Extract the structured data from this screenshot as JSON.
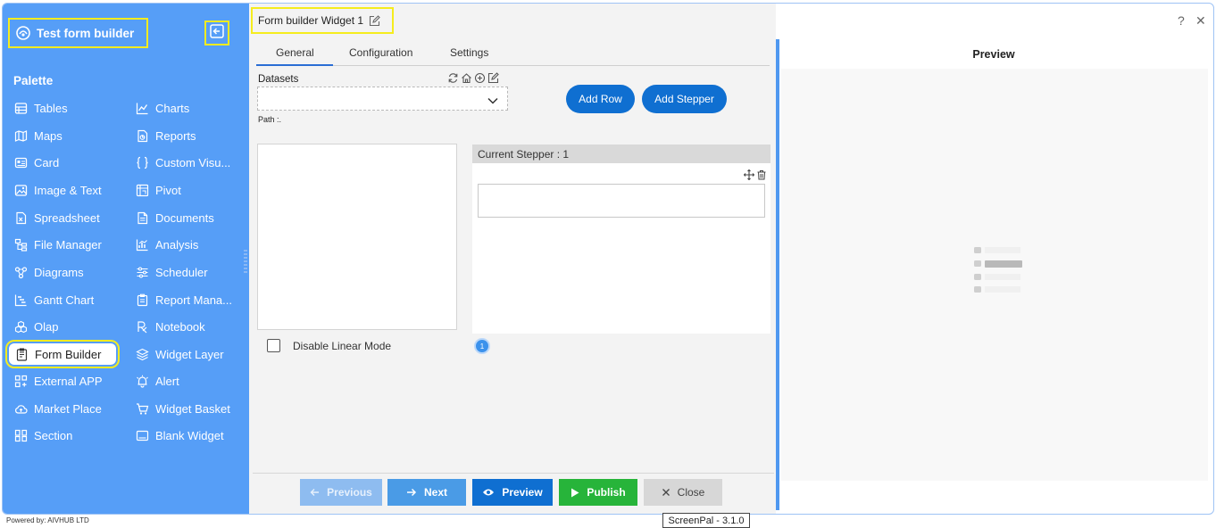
{
  "sidebar": {
    "app_title": "Test form builder",
    "palette_title": "Palette",
    "left_items": [
      "Tables",
      "Maps",
      "Card",
      "Image & Text",
      "Spreadsheet",
      "File Manager",
      "Diagrams",
      "Gantt Chart",
      "Olap",
      "Form Builder",
      "External APP",
      "Market Place",
      "Section"
    ],
    "right_items": [
      "Charts",
      "Reports",
      "Custom Visu...",
      "Pivot",
      "Documents",
      "Analysis",
      "Scheduler",
      "Report Mana...",
      "Notebook",
      "Widget Layer",
      "Alert",
      "Widget Basket",
      "Blank Widget"
    ],
    "active_item": "Form Builder",
    "powered_by": "Powered by: AIVHUB LTD"
  },
  "widget": {
    "title": "Form builder Widget 1",
    "tabs": [
      "General",
      "Configuration",
      "Settings"
    ],
    "active_tab": "General",
    "datasets_label": "Datasets",
    "path_label": "Path :.",
    "add_row_label": "Add Row",
    "add_stepper_label": "Add Stepper",
    "stepper_header": "Current Stepper : 1",
    "disable_linear_label": "Disable Linear Mode",
    "step_number": "1"
  },
  "footer": {
    "previous_label": "Previous",
    "next_label": "Next",
    "preview_label": "Preview",
    "publish_label": "Publish",
    "close_label": "Close"
  },
  "preview": {
    "title": "Preview"
  },
  "window": {
    "help_glyph": "?",
    "close_glyph": "✕"
  },
  "overlay": {
    "screenpal": "ScreenPal - 3.1.0"
  },
  "colors": {
    "sidebar_bg": "#569ef7",
    "highlight": "#f5ec1e",
    "primary_button": "#0f6fd1",
    "publish": "#27b43a",
    "next": "#4a9be6",
    "previous_disabled": "#8ebcf0"
  }
}
